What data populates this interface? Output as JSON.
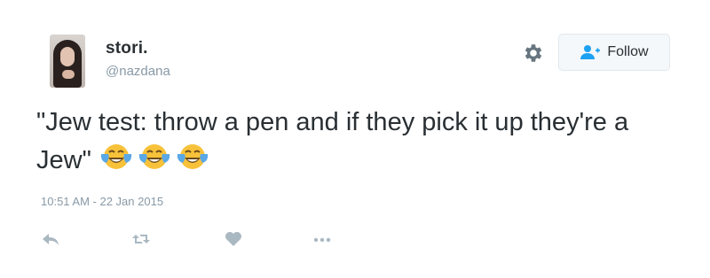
{
  "tweet": {
    "author": {
      "display_name": "stori.",
      "handle": "@nazdana",
      "avatar_icon": "profile-photo"
    },
    "follow_button": {
      "label": "Follow",
      "icon": "follow-user-icon"
    },
    "settings_icon": "gear-icon",
    "text": "\"Jew test: throw a pen and if they pick it up they're a Jew\"",
    "emoji": [
      "face-with-tears-of-joy",
      "face-with-tears-of-joy",
      "face-with-tears-of-joy"
    ],
    "timestamp": "10:51 AM - 22 Jan 2015",
    "actions": [
      "reply-icon",
      "retweet-icon",
      "like-icon",
      "more-icon"
    ],
    "colors": {
      "text": "#292f33",
      "muted": "#8899a6",
      "follow_icon": "#1da1f2",
      "emoji_face": "#f7c23a",
      "emoji_tears": "#5aa8e6"
    }
  }
}
